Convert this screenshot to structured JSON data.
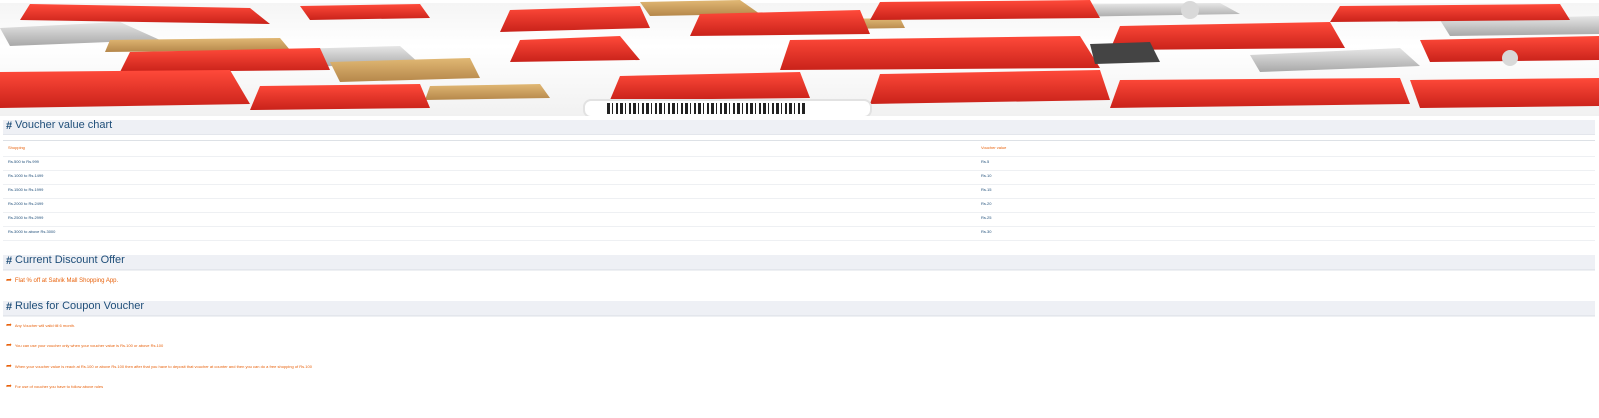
{
  "banner": {
    "alt": "sale banner"
  },
  "voucher_chart": {
    "title": "Voucher value chart",
    "columns": [
      "Shopping",
      "Voucher value"
    ],
    "rows": [
      [
        "Rs.500 to Rs.999",
        "Rs.5"
      ],
      [
        "Rs.1000 to Rs.1499",
        "Rs.10"
      ],
      [
        "Rs.1500 to Rs.1999",
        "Rs.15"
      ],
      [
        "Rs.2000 to Rs.2499",
        "Rs.20"
      ],
      [
        "Rs.2500 to Rs.2999",
        "Rs.25"
      ],
      [
        "Rs.3000 to above Rs.3000",
        "Rs.30"
      ]
    ]
  },
  "discount_offer": {
    "title": "Current Discount Offer",
    "text": "Flat % off at Satvik Mall Shopping App."
  },
  "rules": {
    "title": "Rules for Coupon Voucher",
    "items": [
      "Any Voucher will valid till 6 month.",
      "You can use your voucher only when your voucher value is Rs.100 or above Rs.100",
      "When your voucher value is reach at Rs.100 or above Rs.100 then after that you have to deposit that voucher at counter and then you can do a free shopping of Rs.100",
      "For use of voucher you have to follow above rules"
    ]
  },
  "colors": {
    "heading": "#1f4e79",
    "accent": "#e8620c",
    "section_bg": "#eef0f5"
  }
}
